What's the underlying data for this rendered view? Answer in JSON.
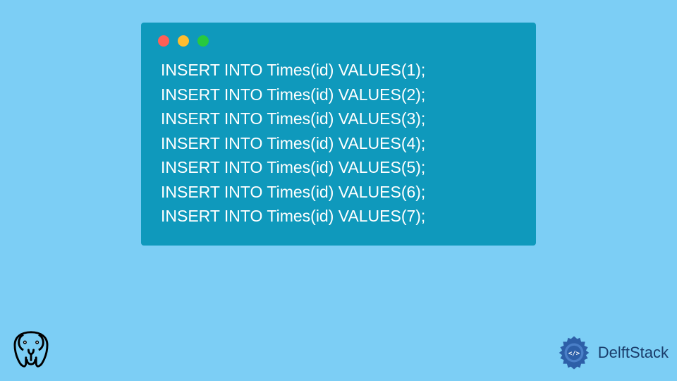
{
  "code": {
    "lines": [
      "INSERT INTO Times(id) VALUES(1);",
      "INSERT INTO Times(id) VALUES(2);",
      "INSERT INTO Times(id) VALUES(3);",
      "INSERT INTO Times(id) VALUES(4);",
      "INSERT INTO Times(id) VALUES(5);",
      "INSERT INTO Times(id) VALUES(6);",
      "INSERT INTO Times(id) VALUES(7);"
    ]
  },
  "branding": {
    "delftstack": "DelftStack"
  }
}
